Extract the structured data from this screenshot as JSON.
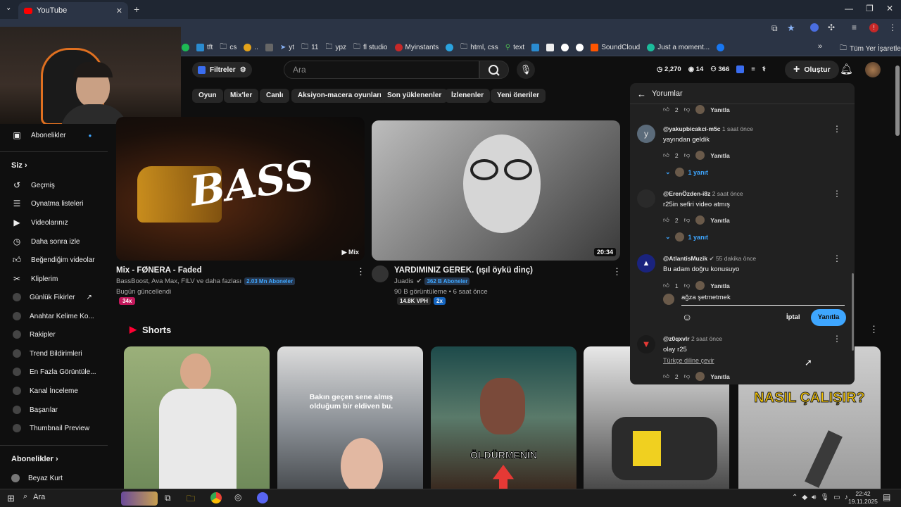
{
  "browser": {
    "tab_title": "YouTube",
    "bookmarks": [
      "tft",
      "cs",
      "yt",
      "11",
      "ypz",
      "fl studio",
      "Myinstants",
      "html, css",
      "text",
      "SoundCloud",
      "Just a moment..."
    ],
    "bookmarks_folder": "Tüm Yer İşaretleri"
  },
  "header": {
    "filters_label": "Filtreler",
    "search_placeholder": "Ara",
    "stats": {
      "views": "2,270",
      "watching": "14",
      "subs": "366"
    },
    "create_label": "Oluştur"
  },
  "chips": [
    "Oyun",
    "Mix'ler",
    "Canlı",
    "Aksiyon-macera oyunları",
    "Son yüklenenler",
    "İzlenenler",
    "Yeni öneriler"
  ],
  "sidebar": {
    "subscriptions_top": "Abonelikler",
    "you_section": "Siz",
    "items": [
      "Geçmiş",
      "Oynatma listeleri",
      "Videolarınız",
      "Daha sonra izle",
      "Beğendiğim videolar",
      "Kliplerim"
    ],
    "ext_items": [
      "Günlük Fikirler",
      "Anahtar Kelime Ko...",
      "Rakipler",
      "Trend Bildirimleri",
      "En Fazla Görüntüle...",
      "Kanal İnceleme",
      "Başarılar",
      "Thumbnail Preview"
    ],
    "subscriptions_section": "Abonelikler",
    "sub_channel": "Beyaz Kurt"
  },
  "videos": [
    {
      "title": "Mix - FØNERA - Faded",
      "channel": "BassBoost, Ava Max, FILV ve daha fazlası",
      "subs_badge": "2.03 Mn Aboneler",
      "meta": "Bugün güncellendi",
      "badge": "34x",
      "overlay": "Mix",
      "thumb_text": "BASS"
    },
    {
      "title": "YARDIMINIZ GEREK. (ışıl öykü dinç)",
      "channel": "Juadis",
      "subs_badge": "362 B Aboneler",
      "meta": "90 B görüntüleme • 6 saat önce",
      "vph": "14.8K VPH",
      "badge": "2x",
      "duration": "20:34"
    }
  ],
  "shorts": {
    "label": "Shorts",
    "captions": [
      "Bakın geçen sene almış olduğum bir eldiven bu.",
      "ÖLDÜRMENİN",
      "NASIL ÇALIŞIR?"
    ]
  },
  "comments": {
    "title": "Yorumlar",
    "reply_label": "Yanıtla",
    "top_likes": "2",
    "items": [
      {
        "author": "@yakupbicakci-m5c",
        "time": "1 saat önce",
        "text": "yayından geldik",
        "likes": "2",
        "replies": "1 yanıt",
        "avatar_letter": "y"
      },
      {
        "author": "@ErenÖzden-i8z",
        "time": "2 saat önce",
        "text": "r25in sefiri video atmış",
        "likes": "2",
        "replies": "1 yanıt"
      },
      {
        "author": "@AtlantisMuzik",
        "time": "55 dakika önce",
        "text": "Bu adam doğru konusuyo",
        "likes": "1"
      },
      {
        "author": "@z0qxvlr",
        "time": "2 saat önce",
        "text": "olay r25",
        "likes": "2",
        "translate": "Türkçe diline çevir"
      }
    ],
    "reply_input_value": "ağza şetmetmek",
    "cancel_label": "İptal",
    "submit_label": "Yanıtla"
  },
  "taskbar": {
    "search": "Ara",
    "time": "22:42",
    "date": "19.11.2025"
  }
}
